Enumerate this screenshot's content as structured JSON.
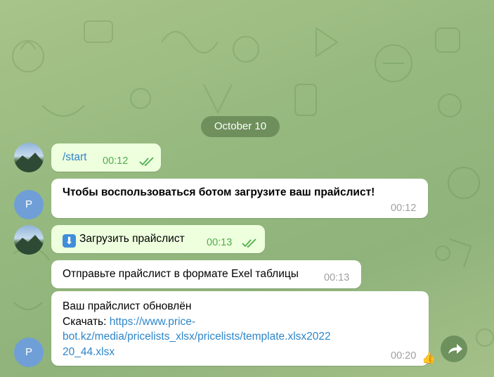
{
  "date_separator": "October 10",
  "messages": [
    {
      "side": "out",
      "text": "/start",
      "time": "00:12"
    },
    {
      "side": "in",
      "sender_initial": "P",
      "text": "Чтобы воспользоваться ботом загрузите ваш прайслист!",
      "time": "00:12"
    },
    {
      "side": "out",
      "emoji": "⬇",
      "text": "Загрузить прайслист",
      "time": "00:13"
    },
    {
      "side": "in",
      "text": "Отправьте прайслист в формате Exel таблицы",
      "time": "00:13"
    },
    {
      "side": "in",
      "sender_initial": "P",
      "line1": "Ваш прайслист обновлён",
      "download_label": "Скачать: ",
      "link_line1": "https://www.price-",
      "link_line2": "bot.kz/media/pricelists_xlsx/pricelists/template.xlsx2022",
      "link_line3": "20_44.xlsx",
      "time": "00:20",
      "reaction": "👍"
    }
  ],
  "icons": {
    "read_receipt": "double-check-icon",
    "share": "share-arrow-icon",
    "download": "down-arrow-icon"
  }
}
